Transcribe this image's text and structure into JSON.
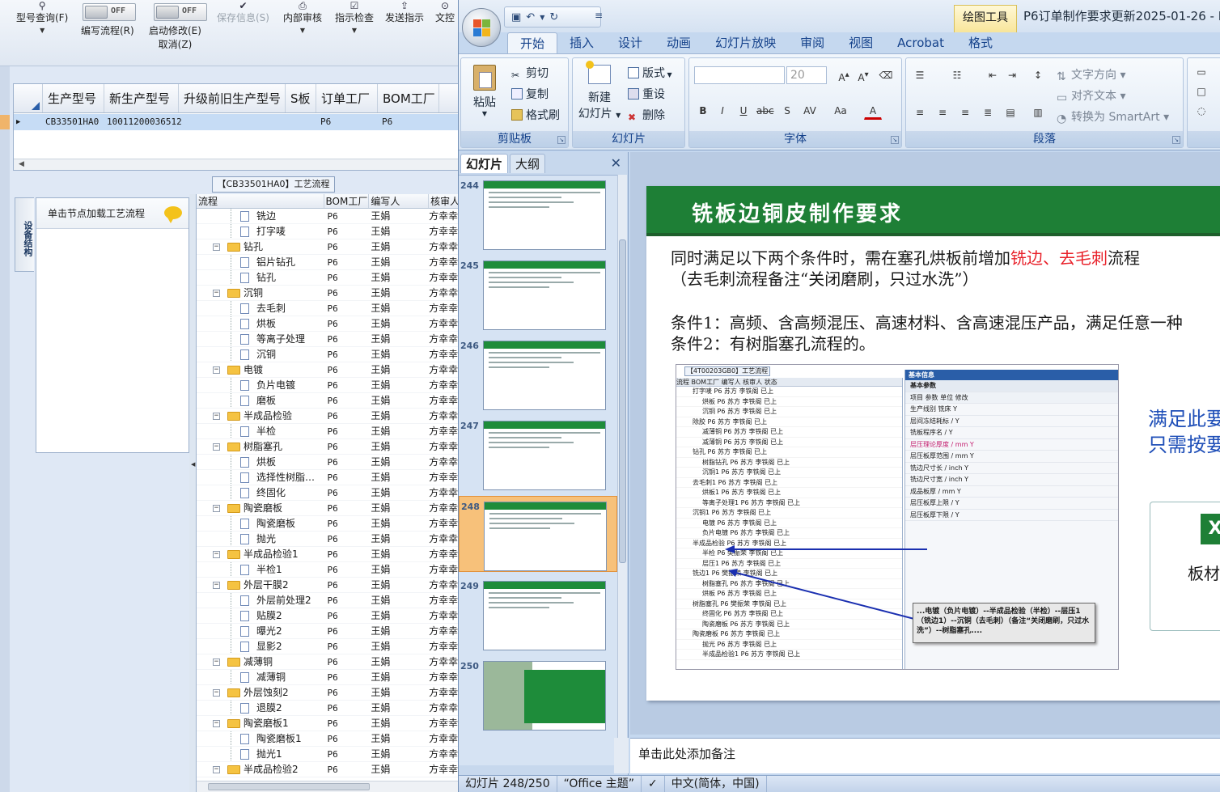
{
  "left_app": {
    "toolbar": {
      "model_query": "型号查询(F)",
      "write_process": "编写流程(R)",
      "write_toggle": "OFF",
      "enable_modify": "启动修改(E)",
      "cancel": "取消(Z)",
      "enable_toggle": "OFF",
      "save_info": "保存信息(S)",
      "internal_review": "内部审核",
      "check_instruction": "指示检查",
      "send_instruction": "发送指示",
      "doc": "文控"
    },
    "grid": {
      "headers": [
        "生产型号",
        "新生产型号",
        "升级前旧生产型号",
        "S板",
        "订单工厂",
        "BOM工厂"
      ],
      "row": [
        "CB33501HA0",
        "10011200036512",
        "",
        "P6",
        "P6"
      ]
    },
    "process_title": "【CB33501HA0】工艺流程",
    "side_tab": "设备结构",
    "node_panel_header": "单击节点加载工艺流程",
    "tree_headers": [
      "流程",
      "BOM工厂",
      "编写人",
      "核审人"
    ],
    "tree_rows": [
      {
        "name": "铣边",
        "type": "leaf",
        "bom": "P6",
        "writer": "王娟",
        "reviewer": "方幸幸"
      },
      {
        "name": "打字唛",
        "type": "leaf",
        "bom": "P6",
        "writer": "王娟",
        "reviewer": "方幸幸"
      },
      {
        "name": "钻孔",
        "type": "folder",
        "bom": "P6",
        "writer": "王娟",
        "reviewer": "方幸幸"
      },
      {
        "name": "铝片钻孔",
        "type": "leaf",
        "bom": "P6",
        "writer": "王娟",
        "reviewer": "方幸幸"
      },
      {
        "name": "钻孔",
        "type": "leaf",
        "bom": "P6",
        "writer": "王娟",
        "reviewer": "方幸幸"
      },
      {
        "name": "沉铜",
        "type": "folder",
        "bom": "P6",
        "writer": "王娟",
        "reviewer": "方幸幸"
      },
      {
        "name": "去毛刺",
        "type": "leaf",
        "bom": "P6",
        "writer": "王娟",
        "reviewer": "方幸幸"
      },
      {
        "name": "烘板",
        "type": "leaf",
        "bom": "P6",
        "writer": "王娟",
        "reviewer": "方幸幸"
      },
      {
        "name": "等离子处理",
        "type": "leaf",
        "bom": "P6",
        "writer": "王娟",
        "reviewer": "方幸幸"
      },
      {
        "name": "沉铜",
        "type": "leaf",
        "bom": "P6",
        "writer": "王娟",
        "reviewer": "方幸幸"
      },
      {
        "name": "电镀",
        "type": "folder",
        "bom": "P6",
        "writer": "王娟",
        "reviewer": "方幸幸"
      },
      {
        "name": "负片电镀",
        "type": "leaf",
        "bom": "P6",
        "writer": "王娟",
        "reviewer": "方幸幸"
      },
      {
        "name": "磨板",
        "type": "leaf",
        "bom": "P6",
        "writer": "王娟",
        "reviewer": "方幸幸"
      },
      {
        "name": "半成品检验",
        "type": "folder",
        "bom": "P6",
        "writer": "王娟",
        "reviewer": "方幸幸"
      },
      {
        "name": "半检",
        "type": "leaf",
        "bom": "P6",
        "writer": "王娟",
        "reviewer": "方幸幸"
      },
      {
        "name": "树脂塞孔",
        "type": "folder",
        "bom": "P6",
        "writer": "王娟",
        "reviewer": "方幸幸"
      },
      {
        "name": "烘板",
        "type": "leaf",
        "bom": "P6",
        "writer": "王娟",
        "reviewer": "方幸幸"
      },
      {
        "name": "选择性树脂…",
        "type": "leaf",
        "bom": "P6",
        "writer": "王娟",
        "reviewer": "方幸幸"
      },
      {
        "name": "终固化",
        "type": "leaf",
        "bom": "P6",
        "writer": "王娟",
        "reviewer": "方幸幸"
      },
      {
        "name": "陶瓷磨板",
        "type": "folder",
        "bom": "P6",
        "writer": "王娟",
        "reviewer": "方幸幸"
      },
      {
        "name": "陶瓷磨板",
        "type": "leaf",
        "bom": "P6",
        "writer": "王娟",
        "reviewer": "方幸幸"
      },
      {
        "name": "抛光",
        "type": "leaf",
        "bom": "P6",
        "writer": "王娟",
        "reviewer": "方幸幸"
      },
      {
        "name": "半成品检验1",
        "type": "folder",
        "bom": "P6",
        "writer": "王娟",
        "reviewer": "方幸幸"
      },
      {
        "name": "半检1",
        "type": "leaf",
        "bom": "P6",
        "writer": "王娟",
        "reviewer": "方幸幸"
      },
      {
        "name": "外层干膜2",
        "type": "folder",
        "bom": "P6",
        "writer": "王娟",
        "reviewer": "方幸幸"
      },
      {
        "name": "外层前处理2",
        "type": "leaf",
        "bom": "P6",
        "writer": "王娟",
        "reviewer": "方幸幸"
      },
      {
        "name": "贴膜2",
        "type": "leaf",
        "bom": "P6",
        "writer": "王娟",
        "reviewer": "方幸幸"
      },
      {
        "name": "曝光2",
        "type": "leaf",
        "bom": "P6",
        "writer": "王娟",
        "reviewer": "方幸幸"
      },
      {
        "name": "显影2",
        "type": "leaf",
        "bom": "P6",
        "writer": "王娟",
        "reviewer": "方幸幸"
      },
      {
        "name": "减薄铜",
        "type": "folder",
        "bom": "P6",
        "writer": "王娟",
        "reviewer": "方幸幸"
      },
      {
        "name": "减薄铜",
        "type": "leaf",
        "bom": "P6",
        "writer": "王娟",
        "reviewer": "方幸幸"
      },
      {
        "name": "外层蚀刻2",
        "type": "folder",
        "bom": "P6",
        "writer": "王娟",
        "reviewer": "方幸幸"
      },
      {
        "name": "退膜2",
        "type": "leaf",
        "bom": "P6",
        "writer": "王娟",
        "reviewer": "方幸幸"
      },
      {
        "name": "陶瓷磨板1",
        "type": "folder",
        "bom": "P6",
        "writer": "王娟",
        "reviewer": "方幸幸"
      },
      {
        "name": "陶瓷磨板1",
        "type": "leaf",
        "bom": "P6",
        "writer": "王娟",
        "reviewer": "方幸幸"
      },
      {
        "name": "抛光1",
        "type": "leaf",
        "bom": "P6",
        "writer": "王娟",
        "reviewer": "方幸幸"
      },
      {
        "name": "半成品检验2",
        "type": "folder",
        "bom": "P6",
        "writer": "王娟",
        "reviewer": "方幸幸"
      }
    ]
  },
  "ppt": {
    "context_tab": "绘图工具",
    "doc_title": "P6订单制作要求更新2025-01-26 - M",
    "tabs": [
      "开始",
      "插入",
      "设计",
      "动画",
      "幻灯片放映",
      "审阅",
      "视图",
      "Acrobat",
      "格式"
    ],
    "clipboard": {
      "paste": "粘贴",
      "cut": "剪切",
      "copy": "复制",
      "format_painter": "格式刷",
      "group": "剪贴板"
    },
    "slides": {
      "new_slide": "新建",
      "new_slide2": "幻灯片",
      "layout": "版式",
      "reset": "重设",
      "delete": "删除",
      "group": "幻灯片"
    },
    "font": {
      "size": "20",
      "group": "字体"
    },
    "paragraph": {
      "text_direction": "文字方向",
      "align_text": "对齐文本",
      "smartart": "转换为 SmartArt",
      "group": "段落"
    },
    "pane_tabs": [
      "幻灯片",
      "大纲"
    ],
    "thumb_numbers": [
      "244",
      "245",
      "246",
      "247",
      "248",
      "249",
      "250"
    ],
    "slide": {
      "title": "铣板边铜皮制作要求",
      "line1_a": "同时满足以下两个条件时，需在塞孔烘板前增加",
      "line1_red": "铣边、去毛刺",
      "line1_b": "流程",
      "line2": "（去毛刺流程备注“关闭磨刷，只过水洗”）",
      "cond1": "条件1：高频、含高频混压、高速材料、含高速混压产品，满足任意一种",
      "cond2": "条件2：有树脂塞孔流程的。",
      "side1": "满足此要",
      "side2": "只需按要",
      "card_label": "板材"
    },
    "embedded": {
      "title": "【4T00203GB0】工艺流程",
      "grid_headers": "流程                BOM工厂  编写人   核审人   状态",
      "grid_rows": [
        "打字唛  P6  苏方  李铁阁  已上",
        "烘板  P6  苏方  李铁阁  已上",
        "沉铜  P6  苏方  李铁阁  已上",
        "除胶  P6  苏方  李铁阁  已上",
        "减薄铜  P6  苏方  李铁阁  已上",
        "减薄铜  P6  苏方  李铁阁  已上",
        "钻孔  P6  苏方  李铁阁  已上",
        "树脂钻孔  P6  苏方  李铁阁  已上",
        "沉铜1  P6  苏方  李铁阁  已上",
        "去毛刺1  P6  苏方  李铁阁  已上",
        "烘板1  P6  苏方  李铁阁  已上",
        "等离子处理1  P6  苏方  李铁阁  已上",
        "沉铜1  P6  苏方  李铁阁  已上",
        "电镀  P6  苏方  李铁阁  已上",
        "负片电镀  P6  苏方  李铁阁  已上",
        "半成品检验  P6  苏方  李铁阁  已上",
        "半检  P6  樊振荣  李铁阁  已上",
        "层压1  P6  苏方  李铁阁  已上",
        "铣边1  P6  樊振荣  李铁阁  已上",
        "树脂塞孔  P6  苏方  李铁阁  已上",
        "烘板  P6  苏方  李铁阁  已上",
        "树脂塞孔  P6  樊振荣  李铁阁  已上",
        "终固化  P6  苏方  李铁阁  已上",
        "陶瓷磨板  P6  苏方  李铁阁  已上",
        "陶瓷磨板  P6  苏方  李铁阁  已上",
        "抛光  P6  苏方  李铁阁  已上",
        "半成品检验1  P6  苏方  李铁阁  已上"
      ],
      "props_header": "基本信息",
      "props_sub": "基本参数",
      "props_cols": "项目          参数          单位   修改",
      "props_rows": [
        "生产线别   铣床   Y",
        "层间冻结耗标   /   Y",
        "铣板程序名   /   Y",
        "层压理论厚度   /   mm   Y",
        "层压板厚范围   /   mm   Y",
        "铣边尺寸长   /   inch   Y",
        "铣边尺寸宽   /   inch   Y",
        "成品板厚   /   mm   Y",
        "层压板厚上限   /   Y",
        "层压板厚下限   /   Y"
      ],
      "callout": "...电镀（负片电镀）--半成品检验（半检）--层压1（铣边1）--沉铜（去毛刺）（备注“关闭磨刷，只过水洗”）--树脂塞孔...."
    },
    "notes": "单击此处添加备注",
    "status": [
      "幻灯片 248/250",
      "“Office 主题”",
      "中文(简体，中国)"
    ]
  }
}
